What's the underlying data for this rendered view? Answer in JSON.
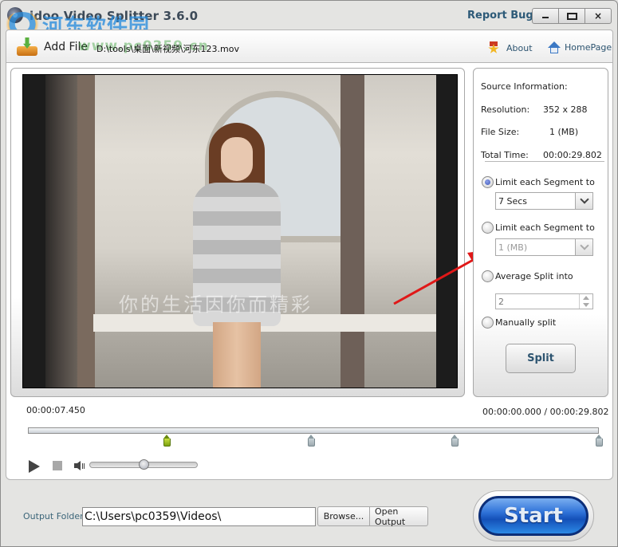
{
  "window": {
    "title": "idoo Video Splitter 3.6.0",
    "watermark": "河东软件园",
    "watermark_url": "www.pc0359.cn",
    "report_bugs": "Report Bugs",
    "controls": {
      "minimize": "minimize",
      "maximize": "maximize",
      "close": "×"
    }
  },
  "toolbar": {
    "add_file": "Add File",
    "file_path": "D:\\tools\\桌面\\新视频\\河东123.mov",
    "about": "About",
    "homepage": "HomePage"
  },
  "video": {
    "subtitle": "你的生活因你而精彩"
  },
  "source_info": {
    "heading": "Source Information:",
    "rows": [
      {
        "label": "Resolution:",
        "value": "352 x 288"
      },
      {
        "label": "File Size:",
        "value": "1 (MB)"
      },
      {
        "label": "Total Time:",
        "value": "00:00:29.802"
      }
    ]
  },
  "split_options": {
    "options": [
      {
        "label": "Limit each Segment to",
        "selected": true,
        "value": "7 Secs"
      },
      {
        "label": "Limit each Segment to",
        "selected": false,
        "value": "1 (MB)"
      },
      {
        "label": "Average Split into",
        "selected": false,
        "value": "2"
      },
      {
        "label": "Manually split",
        "selected": false
      }
    ],
    "split_button": "Split"
  },
  "playback": {
    "current_time": "00:00:07.450",
    "position_range": "00:00:00.000 / 00:00:29.802",
    "markers": [
      {
        "position": 0.25,
        "active": true
      },
      {
        "position": 0.5,
        "active": false
      },
      {
        "position": 0.75,
        "active": false
      },
      {
        "position": 1.0,
        "active": false
      }
    ],
    "volume": 0.5
  },
  "output": {
    "label": "Output Folder:",
    "folder": "C:\\Users\\pc0359\\Videos\\",
    "browse": "Browse...",
    "open_output": "Open Output",
    "start": "Start"
  }
}
